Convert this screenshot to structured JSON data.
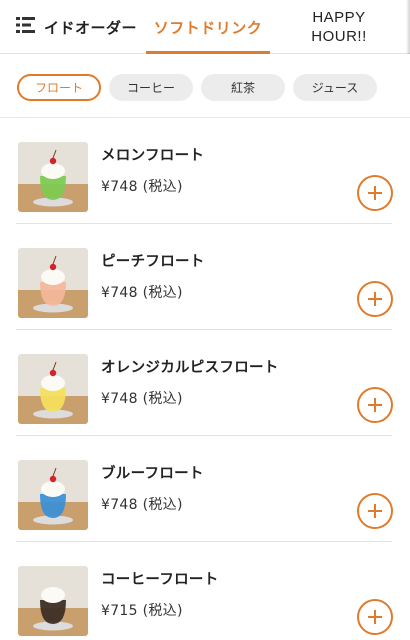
{
  "header": {
    "menu_icon": "list-menu-icon",
    "tabs": [
      {
        "label": "イドオーダー",
        "active": false
      },
      {
        "label": "ソフトドリンク",
        "active": true
      },
      {
        "label_line1": "HAPPY",
        "label_line2": "HOUR!!",
        "active": false
      }
    ]
  },
  "filters": [
    {
      "label": "フロート",
      "active": true
    },
    {
      "label": "コーヒー",
      "active": false
    },
    {
      "label": "紅茶",
      "active": false
    },
    {
      "label": "ジュース",
      "active": false
    }
  ],
  "items": [
    {
      "name": "メロンフロート",
      "price": "¥748 (税込)",
      "drink_color": "#7ccb4f",
      "add_icon": "plus-icon"
    },
    {
      "name": "ピーチフロート",
      "price": "¥748 (税込)",
      "drink_color": "#f4b79a",
      "add_icon": "plus-icon"
    },
    {
      "name": "オレンジカルピスフロート",
      "price": "¥748 (税込)",
      "drink_color": "#f6df5c",
      "add_icon": "plus-icon"
    },
    {
      "name": "ブルーフロート",
      "price": "¥748 (税込)",
      "drink_color": "#3a8fd6",
      "add_icon": "plus-icon"
    },
    {
      "name": "コーヒーフロート",
      "price": "¥715 (税込)",
      "drink_color": "#3a2a22",
      "add_icon": "plus-icon"
    }
  ],
  "colors": {
    "accent": "#e07b2c",
    "chip_bg": "#ececec",
    "divider": "#e3e3e3"
  }
}
